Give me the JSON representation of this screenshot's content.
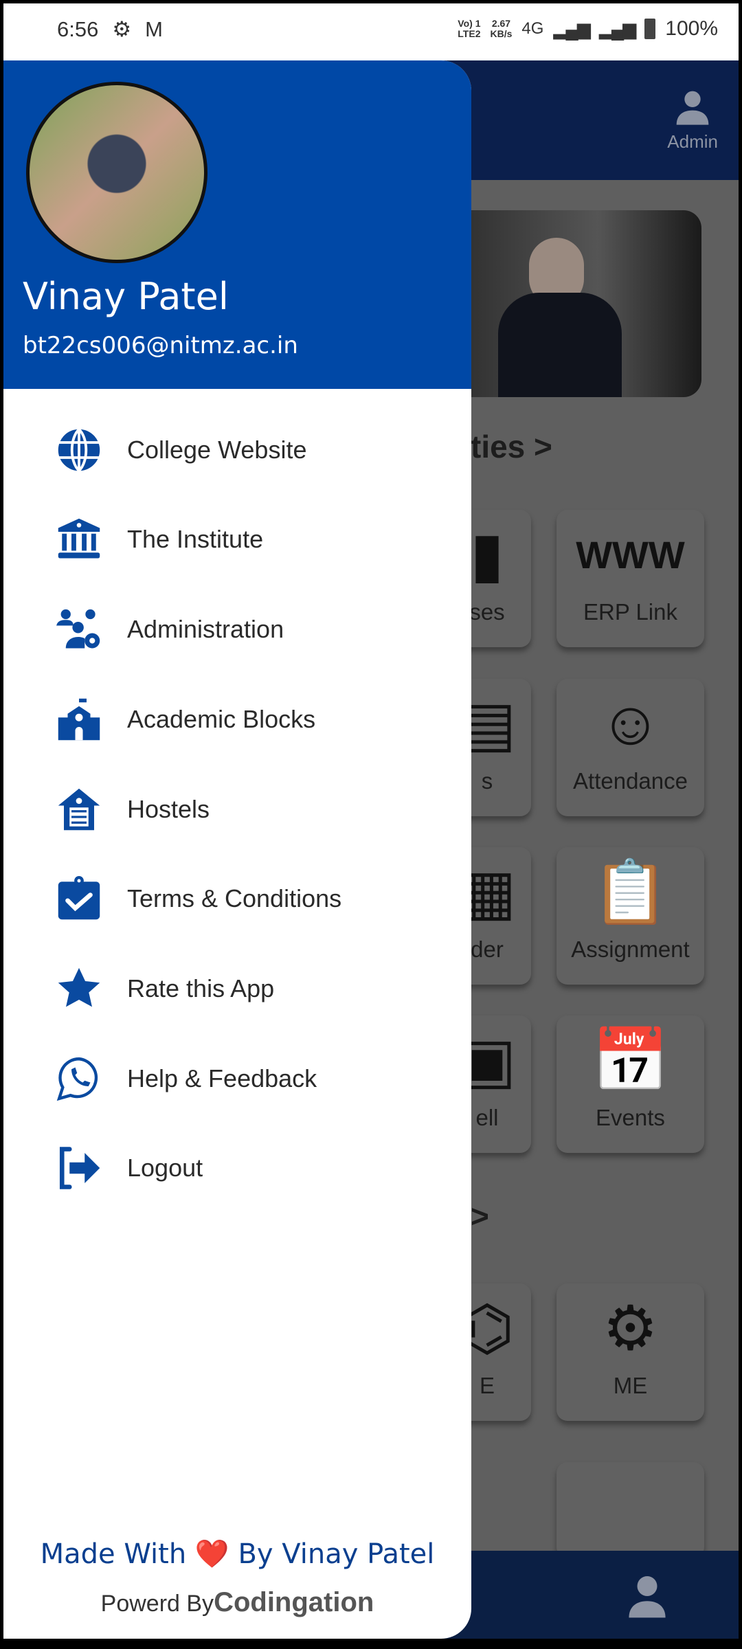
{
  "status_bar": {
    "time": "6:56",
    "net_top": "Vo) 1",
    "net_bottom": "LTE2",
    "speed_top": "2.67",
    "speed_bottom": "KB/s",
    "network": "4G",
    "battery": "100%"
  },
  "background_app": {
    "admin_label": "Admin",
    "section1_partial": "ties >",
    "section2_partial": ">",
    "tiles": [
      {
        "label": "ses"
      },
      {
        "label": "ERP Link"
      },
      {
        "label": "s"
      },
      {
        "label": "Attendance"
      },
      {
        "label": "der"
      },
      {
        "label": "Assignment"
      },
      {
        "label": "ell"
      },
      {
        "label": "Events"
      },
      {
        "label": "E"
      },
      {
        "label": "ME"
      }
    ]
  },
  "drawer": {
    "user_name": "Vinay Patel",
    "user_email": "bt22cs006@nitmz.ac.in",
    "items": [
      {
        "label": "College Website",
        "icon": "globe-icon"
      },
      {
        "label": "The Institute",
        "icon": "institution-icon"
      },
      {
        "label": "Administration",
        "icon": "users-gear-icon"
      },
      {
        "label": "Academic Blocks",
        "icon": "school-icon"
      },
      {
        "label": "Hostels",
        "icon": "hostel-icon"
      },
      {
        "label": "Terms & Conditions",
        "icon": "clipboard-check-icon"
      },
      {
        "label": "Rate this App",
        "icon": "star-icon"
      },
      {
        "label": "Help & Feedback",
        "icon": "whatsapp-icon"
      },
      {
        "label": "Logout",
        "icon": "logout-icon"
      }
    ],
    "footer": {
      "made_prefix": "Made With",
      "heart": "❤️",
      "made_suffix": "By Vinay Patel",
      "powered_prefix": "Powerd By",
      "powered_brand": "Codingation"
    }
  },
  "colors": {
    "primary": "#0048a6",
    "icon": "#0a4aa0"
  }
}
